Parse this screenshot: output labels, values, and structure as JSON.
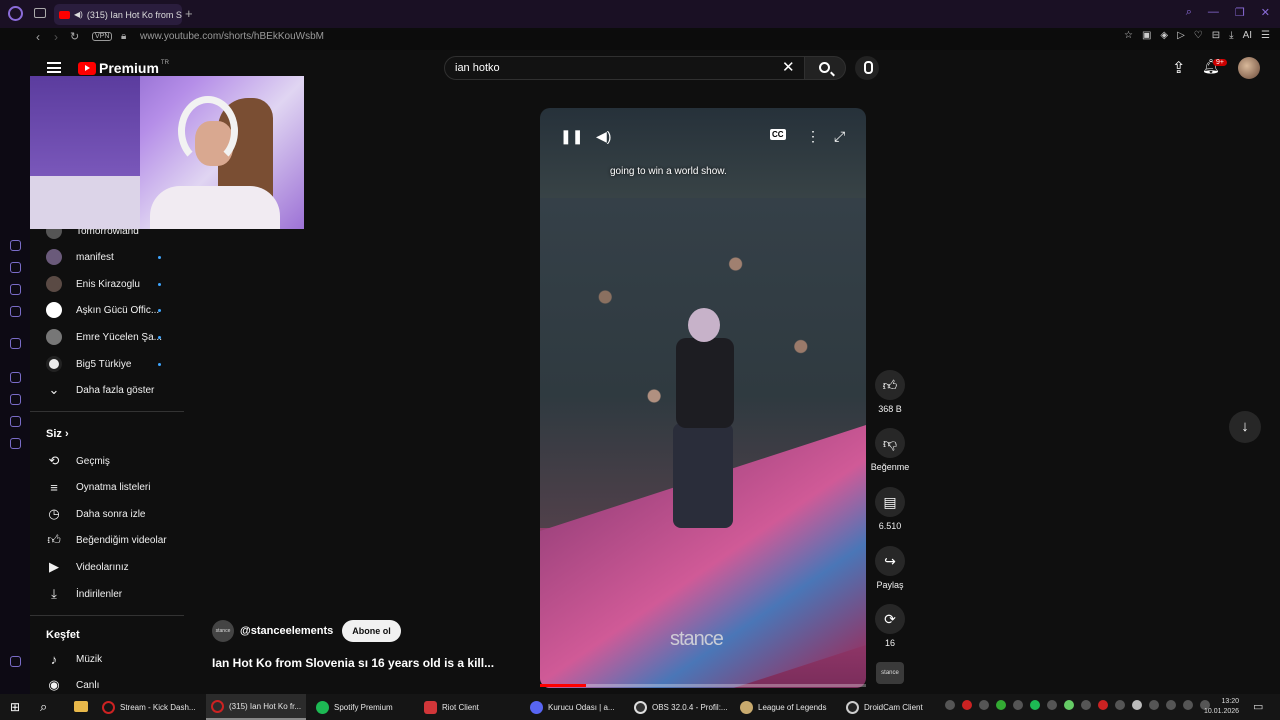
{
  "browser": {
    "tab_title": "(315) Ian Hot Ko from S",
    "url": "www.youtube.com/shorts/hBEkKouWsbM",
    "vpn_label": "VPN",
    "ai_label": "AI"
  },
  "header": {
    "logo": "Premium",
    "logo_region": "TR",
    "search_value": "ian hotko",
    "notif_count": "9+"
  },
  "guide": {
    "subscriptions": [
      "Tomorrowland",
      "manifest",
      "Enis Kirazoglu",
      "Aşkın Gücü Offic...",
      "Emre Yücelen Şa...",
      "Big5 Türkiye"
    ],
    "show_more": "Daha fazla göster",
    "you_heading": "Siz",
    "you_items": [
      "Geçmiş",
      "Oynatma listeleri",
      "Daha sonra izle",
      "Beğendiğim videolar",
      "Videolarınız",
      "İndirilenler"
    ],
    "explore_heading": "Keşfet",
    "explore_items": [
      "Müzik",
      "Canlı"
    ]
  },
  "player": {
    "caption": "going to win a world show.",
    "watermark": "stance",
    "progress_fraction": 0.14
  },
  "actions": {
    "likes": "368 B",
    "dislike_label": "Beğenme",
    "comments": "6.510",
    "share_label": "Paylaş",
    "remix_count": "16",
    "channel_thumb_text": "stance"
  },
  "video": {
    "channel": "@stanceelements",
    "channel_avatar_text": "stance",
    "subscribe_label": "Abone ol",
    "title": "Ian Hot Ko from Slovenia sı 16 years old is a kill..."
  },
  "taskbar": {
    "items": [
      "Stream - Kick Dash...",
      "(315) Ian Hot Ko fr...",
      "Spotify Premium",
      "Riot Client",
      "Kurucu Odası | a...",
      "OBS 32.0.4 - Profil:...",
      "League of Legends",
      "DroidCam Client"
    ],
    "time": "13:20",
    "date": "10.01.2026"
  },
  "colors": {
    "accent": "#8b6cd9",
    "youtube_red": "#ff0000",
    "background": "#0f0f0f"
  }
}
